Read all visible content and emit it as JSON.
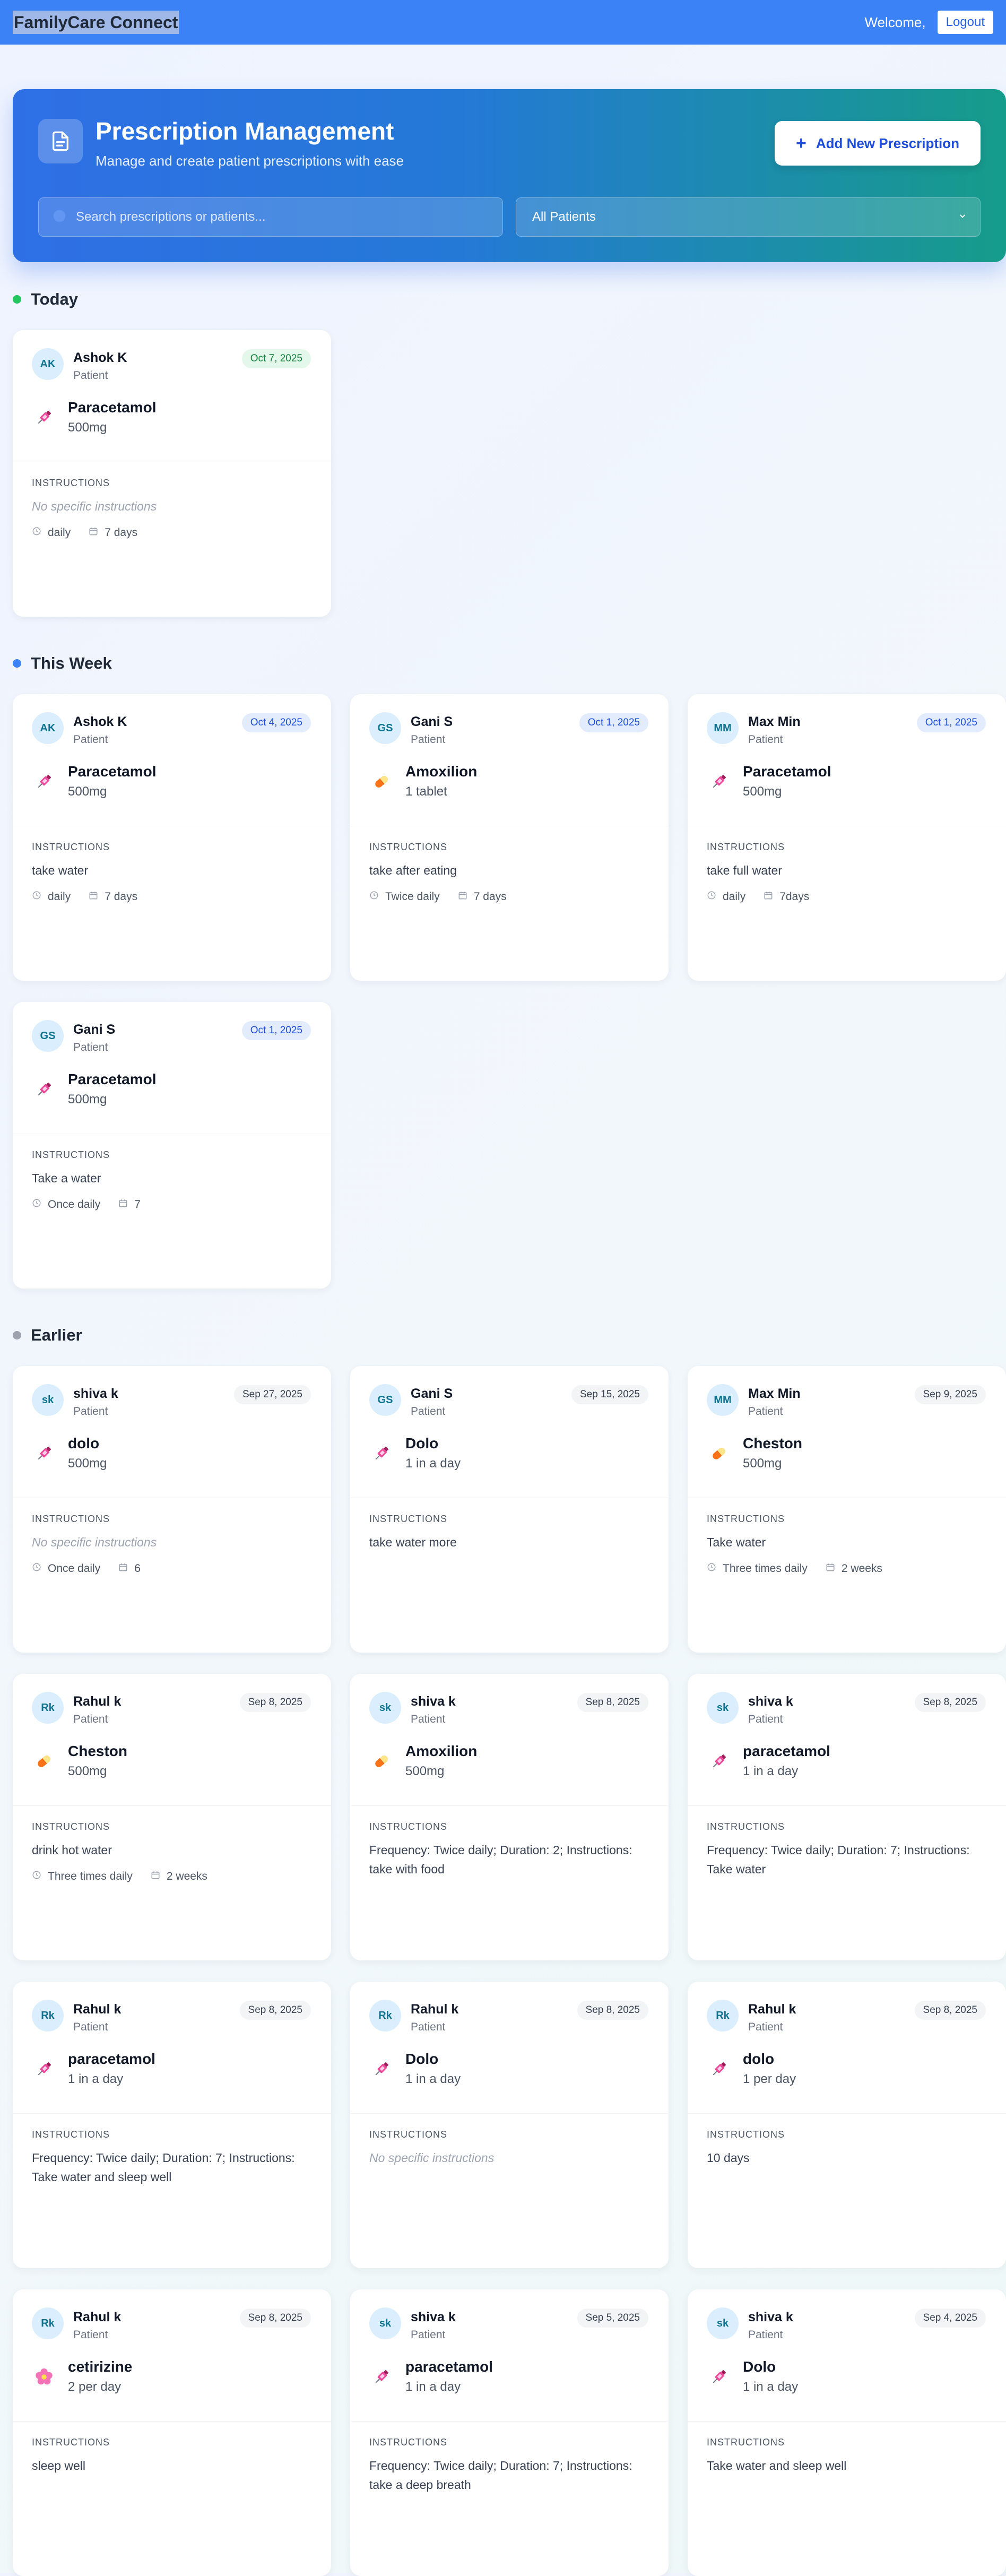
{
  "navbar": {
    "brand": "FamilyCare Connect",
    "welcome": "Welcome,",
    "logout": "Logout"
  },
  "hero": {
    "title": "Prescription Management",
    "subtitle": "Manage and create patient prescriptions with ease",
    "add_button": "Add New Prescription",
    "search_placeholder": "Search prescriptions or patients...",
    "patient_filter": "All Patients"
  },
  "colors": {
    "primary": "#3b82f6",
    "hero_start": "#2f6fe6",
    "hero_end": "#169c8a",
    "today_dot": "#22c55e",
    "week_dot": "#3b82f6",
    "earlier_dot": "#9ca3af"
  },
  "labels": {
    "instructions": "INSTRUCTIONS",
    "patient_role": "Patient"
  },
  "sections": [
    {
      "title": "Today",
      "badge": "today",
      "cards": [
        {
          "initials": "AK",
          "patient": "Ashok K",
          "role": "Patient",
          "date": "Oct 7, 2025",
          "icon": "syringe-icon",
          "medication": "Paracetamol",
          "dose": "500mg",
          "instructions": "No specific instructions",
          "empty": true,
          "frequency": "daily",
          "duration": "7 days"
        }
      ]
    },
    {
      "title": "This Week",
      "badge": "week",
      "cards": [
        {
          "initials": "AK",
          "patient": "Ashok K",
          "role": "Patient",
          "date": "Oct 4, 2025",
          "icon": "syringe-icon",
          "medication": "Paracetamol",
          "dose": "500mg",
          "instructions": "take water",
          "frequency": "daily",
          "duration": "7 days"
        },
        {
          "initials": "GS",
          "patient": "Gani S",
          "role": "Patient",
          "date": "Oct 1, 2025",
          "icon": "capsule-icon",
          "medication": "Amoxilion",
          "dose": "1 tablet",
          "instructions": "take after eating",
          "frequency": "Twice daily",
          "duration": "7 days"
        },
        {
          "initials": "MM",
          "patient": "Max Min",
          "role": "Patient",
          "date": "Oct 1, 2025",
          "icon": "syringe-icon",
          "medication": "Paracetamol",
          "dose": "500mg",
          "instructions": "take full water",
          "frequency": "daily",
          "duration": "7days"
        },
        {
          "initials": "GS",
          "patient": "Gani S",
          "role": "Patient",
          "date": "Oct 1, 2025",
          "icon": "syringe-icon",
          "medication": "Paracetamol",
          "dose": "500mg",
          "instructions": "Take a water",
          "frequency": "Once daily",
          "duration": "7"
        }
      ]
    },
    {
      "title": "Earlier",
      "badge": "earlier",
      "cards": [
        {
          "initials": "sk",
          "patient": "shiva k",
          "role": "Patient",
          "date": "Sep 27, 2025",
          "icon": "syringe-icon",
          "medication": "dolo",
          "dose": "500mg",
          "instructions": "No specific instructions",
          "empty": true,
          "frequency": "Once daily",
          "duration": "6"
        },
        {
          "initials": "GS",
          "patient": "Gani S",
          "role": "Patient",
          "date": "Sep 15, 2025",
          "icon": "syringe-icon",
          "medication": "Dolo",
          "dose": "1 in a day",
          "instructions": "take water more"
        },
        {
          "initials": "MM",
          "patient": "Max Min",
          "role": "Patient",
          "date": "Sep 9, 2025",
          "icon": "capsule-icon",
          "medication": "Cheston",
          "dose": "500mg",
          "instructions": "Take water",
          "frequency": "Three times daily",
          "duration": "2 weeks"
        },
        {
          "initials": "Rk",
          "patient": "Rahul k",
          "role": "Patient",
          "date": "Sep 8, 2025",
          "icon": "capsule-icon",
          "medication": "Cheston",
          "dose": "500mg",
          "instructions": "drink hot water",
          "frequency": "Three times daily",
          "duration": "2 weeks"
        },
        {
          "initials": "sk",
          "patient": "shiva k",
          "role": "Patient",
          "date": "Sep 8, 2025",
          "icon": "capsule-icon",
          "medication": "Amoxilion",
          "dose": "500mg",
          "instructions": "Frequency: Twice daily; Duration: 2; Instructions: take with food"
        },
        {
          "initials": "sk",
          "patient": "shiva k",
          "role": "Patient",
          "date": "Sep 8, 2025",
          "icon": "syringe-icon",
          "medication": "paracetamol",
          "dose": "1 in a day",
          "instructions": "Frequency: Twice daily; Duration: 7; Instructions: Take water"
        },
        {
          "initials": "Rk",
          "patient": "Rahul k",
          "role": "Patient",
          "date": "Sep 8, 2025",
          "icon": "syringe-icon",
          "medication": "paracetamol",
          "dose": "1 in a day",
          "instructions": "Frequency: Twice daily; Duration: 7; Instructions: Take water and sleep well"
        },
        {
          "initials": "Rk",
          "patient": "Rahul k",
          "role": "Patient",
          "date": "Sep 8, 2025",
          "icon": "syringe-icon",
          "medication": "Dolo",
          "dose": "1 in a day",
          "instructions": "No specific instructions",
          "empty": true
        },
        {
          "initials": "Rk",
          "patient": "Rahul k",
          "role": "Patient",
          "date": "Sep 8, 2025",
          "icon": "syringe-icon",
          "medication": "dolo",
          "dose": "1 per day",
          "instructions": "10 days"
        },
        {
          "initials": "Rk",
          "patient": "Rahul k",
          "role": "Patient",
          "date": "Sep 8, 2025",
          "icon": "flower-icon",
          "medication": "cetirizine",
          "dose": "2 per day",
          "instructions": "sleep well"
        },
        {
          "initials": "sk",
          "patient": "shiva k",
          "role": "Patient",
          "date": "Sep 5, 2025",
          "icon": "syringe-icon",
          "medication": "paracetamol",
          "dose": "1 in a day",
          "instructions": "Frequency: Twice daily; Duration: 7; Instructions: take a deep breath"
        },
        {
          "initials": "sk",
          "patient": "shiva k",
          "role": "Patient",
          "date": "Sep 4, 2025",
          "icon": "syringe-icon",
          "medication": "Dolo",
          "dose": "1 in a day",
          "instructions": "Take water and sleep well"
        }
      ]
    }
  ]
}
